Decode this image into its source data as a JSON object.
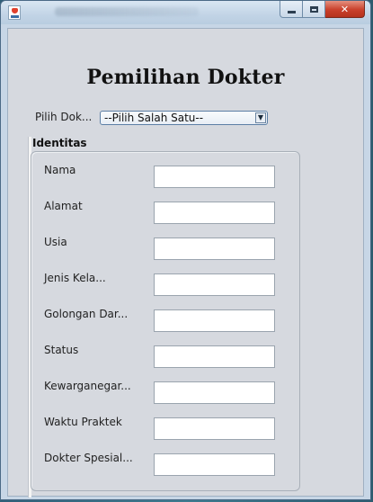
{
  "window": {
    "buttons": {
      "minimize": "minimize",
      "maximize": "maximize",
      "close": "✕"
    }
  },
  "form": {
    "title": "Pemilihan Dokter",
    "doctor_select": {
      "label": "Pilih Dok...",
      "selected": "--Pilih Salah Satu--"
    },
    "section_title": "Identitas",
    "fields": [
      {
        "label": "Nama",
        "value": ""
      },
      {
        "label": "Alamat",
        "value": ""
      },
      {
        "label": "Usia",
        "value": ""
      },
      {
        "label": "Jenis Kela...",
        "value": ""
      },
      {
        "label": "Golongan Dar...",
        "value": ""
      },
      {
        "label": "Status",
        "value": ""
      },
      {
        "label": "Kewarganegar...",
        "value": ""
      },
      {
        "label": "Waktu Praktek",
        "value": ""
      },
      {
        "label": "Dokter Spesial...",
        "value": ""
      }
    ]
  },
  "icons": {
    "app": "java-app-icon",
    "dropdown": "chevron-down-icon"
  }
}
